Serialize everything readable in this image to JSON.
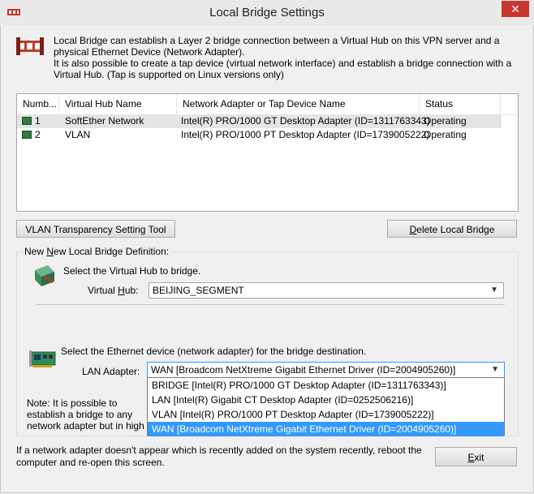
{
  "window": {
    "title": "Local Bridge Settings",
    "close_glyph": "✕"
  },
  "description": {
    "line1": "Local Bridge can establish a Layer 2 bridge connection between a Virtual Hub on this VPN server and a physical Ethernet Device (Network Adapter).",
    "line2": "It is also possible to create a tap device (virtual network interface) and establish a bridge connection with a Virtual Hub. (Tap is supported on Linux versions only)"
  },
  "list": {
    "columns": [
      "Numb...",
      "Virtual Hub Name",
      "Network Adapter or Tap Device Name",
      "Status"
    ],
    "rows": [
      {
        "number": "1",
        "hub": "SoftEther Network",
        "adapter": "Intel(R) PRO/1000 GT Desktop Adapter (ID=1311763343)",
        "status": "Operating"
      },
      {
        "number": "2",
        "hub": "VLAN",
        "adapter": "Intel(R) PRO/1000 PT Desktop Adapter (ID=1739005222)",
        "status": "Operating"
      }
    ]
  },
  "buttons": {
    "vlan_tool": "VLAN Transparency Setting Tool",
    "delete_prefix": "D",
    "delete_rest": "elete Local Bridge",
    "exit_prefix": "E",
    "exit_rest": "xit"
  },
  "group": {
    "label_pre": "New ",
    "label_ul": "N",
    "label_post": "ew Local Bridge Definition:",
    "hub_prompt": "Select the Virtual Hub to bridge.",
    "hub_label_pre": "Virtual ",
    "hub_label_ul": "H",
    "hub_label_post": "ub:",
    "hub_value": "BEIJING_SEGMENT",
    "adapter_prompt": "Select the Ethernet device (network adapter) for the bridge destination.",
    "lan_label": "LAN Adapter:",
    "lan_value": "WAN [Broadcom NetXtreme Gigabit Ethernet Driver (ID=2004905260)]",
    "note": "Note: It is possible to establish a bridge to any network adapter but in high load environments it is recommended to use a dedicated adapter for bridging."
  },
  "dropdown_options": [
    "BRIDGE [Intel(R) PRO/1000 GT Desktop Adapter (ID=1311763343)]",
    "LAN [Intel(R) Gigabit CT Desktop Adapter (ID=0252506216)]",
    "VLAN [Intel(R) PRO/1000 PT Desktop Adapter (ID=1739005222)]",
    "WAN [Broadcom NetXtreme Gigabit Ethernet Driver (ID=2004905260)]"
  ],
  "footer": "If a network adapter doesn't appear which is recently added on the system recently, reboot the computer and re-open this screen.",
  "colors": {
    "selection": "#3399ff",
    "close": "#c7372f",
    "operating_icon": "#2d7d3a"
  }
}
